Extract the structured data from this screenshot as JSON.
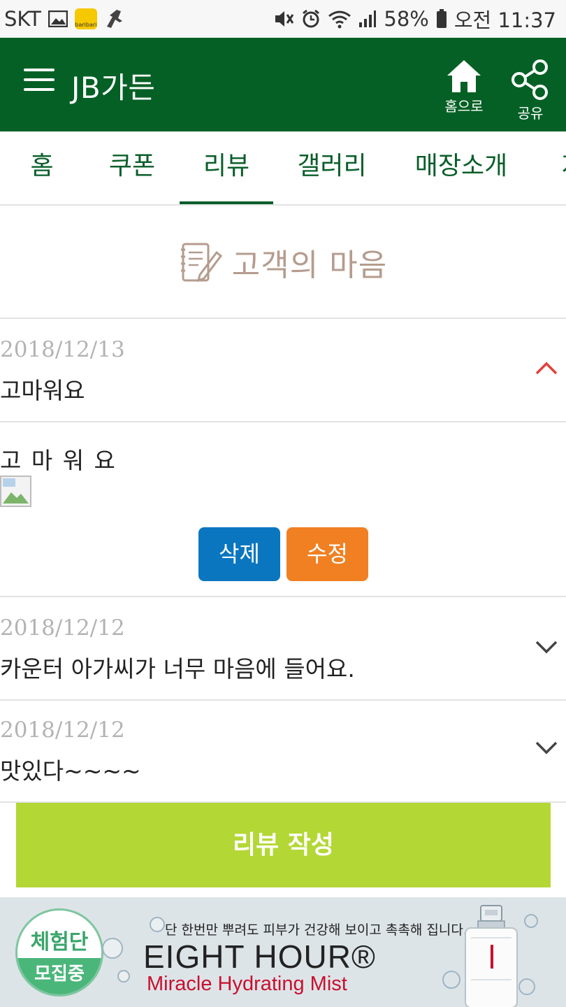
{
  "status_bar": {
    "carrier": "SKT",
    "battery": "58%",
    "time": "오전 11:37",
    "app_badge_text": "baribari"
  },
  "header": {
    "title": "JB가든",
    "home_label": "홈으로",
    "share_label": "공유",
    "color": "#056025"
  },
  "tabs": [
    {
      "label": "홈"
    },
    {
      "label": "쿠폰"
    },
    {
      "label": "리뷰"
    },
    {
      "label": "갤러리"
    },
    {
      "label": "매장소개"
    },
    {
      "label": "지"
    }
  ],
  "active_tab": "리뷰",
  "section_title": "고객의 마음",
  "reviews": [
    {
      "date": "2018/12/13",
      "title": "고마워요",
      "expanded": true,
      "body": "고 마 워 요"
    },
    {
      "date": "2018/12/12",
      "title": "카운터 아가씨가 너무 마음에 들어요.",
      "expanded": false
    },
    {
      "date": "2018/12/12",
      "title": "맛있다~~~~",
      "expanded": false
    }
  ],
  "actions": {
    "delete_label": "삭제",
    "edit_label": "수정",
    "write_review_label": "리뷰 작성"
  },
  "ad": {
    "badge_top": "체험단",
    "badge_bottom": "모집중",
    "tagline": "단 한번만 뿌려도 피부가 건강해 보이고 촉촉해 집니다.",
    "brand": "EIGHT HOUR®",
    "product": "Miracle Hydrating Mist"
  },
  "colors": {
    "accent_green": "#056025",
    "delete_button": "#0b76c0",
    "edit_button": "#f08022",
    "write_button": "#b3d735",
    "collapse_arrow": "#e0403a"
  }
}
